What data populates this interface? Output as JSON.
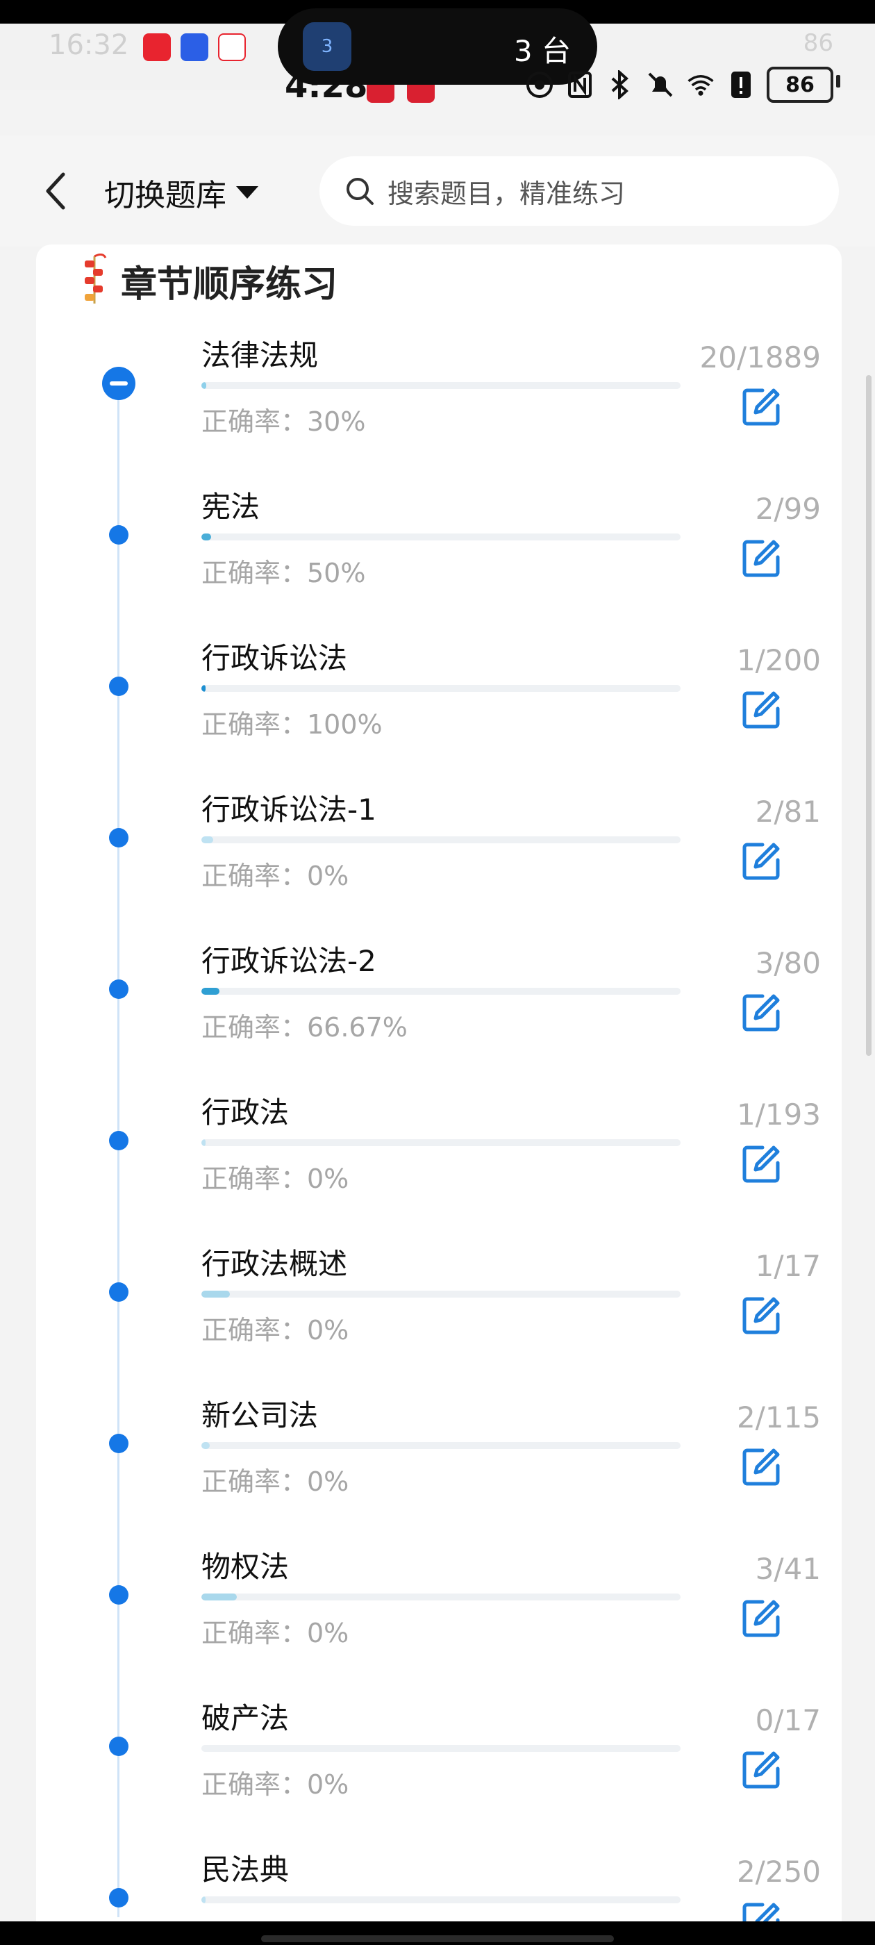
{
  "status": {
    "time_faded": "16:32",
    "time": "4:28",
    "island_badge": "3",
    "island_text": "3 台",
    "battery": "86",
    "battery_faded": "86"
  },
  "header": {
    "switch_label": "切换题库",
    "search_placeholder": "搜索题目，精准练习"
  },
  "section": {
    "title": "章节顺序练习"
  },
  "items": [
    {
      "name": "法律法规",
      "accuracy": "正确率：30%",
      "count": "20/1889",
      "progress": 0.0106,
      "fill": "#8fd0ea",
      "expanded": true
    },
    {
      "name": "宪法",
      "accuracy": "正确率：50%",
      "count": "2/99",
      "progress": 0.0202,
      "fill": "#4aaed8",
      "expanded": false
    },
    {
      "name": "行政诉讼法",
      "accuracy": "正确率：100%",
      "count": "1/200",
      "progress": 0.005,
      "fill": "#1d8fd1",
      "expanded": false
    },
    {
      "name": "行政诉讼法-1",
      "accuracy": "正确率：0%",
      "count": "2/81",
      "progress": 0.0247,
      "fill": "#bfe2f2",
      "expanded": false
    },
    {
      "name": "行政诉讼法-2",
      "accuracy": "正确率：66.67%",
      "count": "3/80",
      "progress": 0.0375,
      "fill": "#2f9fd3",
      "expanded": false
    },
    {
      "name": "行政法",
      "accuracy": "正确率：0%",
      "count": "1/193",
      "progress": 0.0052,
      "fill": "#bfe2f2",
      "expanded": false
    },
    {
      "name": "行政法概述",
      "accuracy": "正确率：0%",
      "count": "1/17",
      "progress": 0.0588,
      "fill": "#a9d8ec",
      "expanded": false
    },
    {
      "name": "新公司法",
      "accuracy": "正确率：0%",
      "count": "2/115",
      "progress": 0.0174,
      "fill": "#bfe2f2",
      "expanded": false
    },
    {
      "name": "物权法",
      "accuracy": "正确率：0%",
      "count": "3/41",
      "progress": 0.0732,
      "fill": "#a9d8ec",
      "expanded": false
    },
    {
      "name": "破产法",
      "accuracy": "正确率：0%",
      "count": "0/17",
      "progress": 0,
      "fill": "#bfe2f2",
      "expanded": false
    },
    {
      "name": "民法典",
      "accuracy": "",
      "count": "2/250",
      "progress": 0.008,
      "fill": "#bfe2f2",
      "expanded": false
    }
  ]
}
